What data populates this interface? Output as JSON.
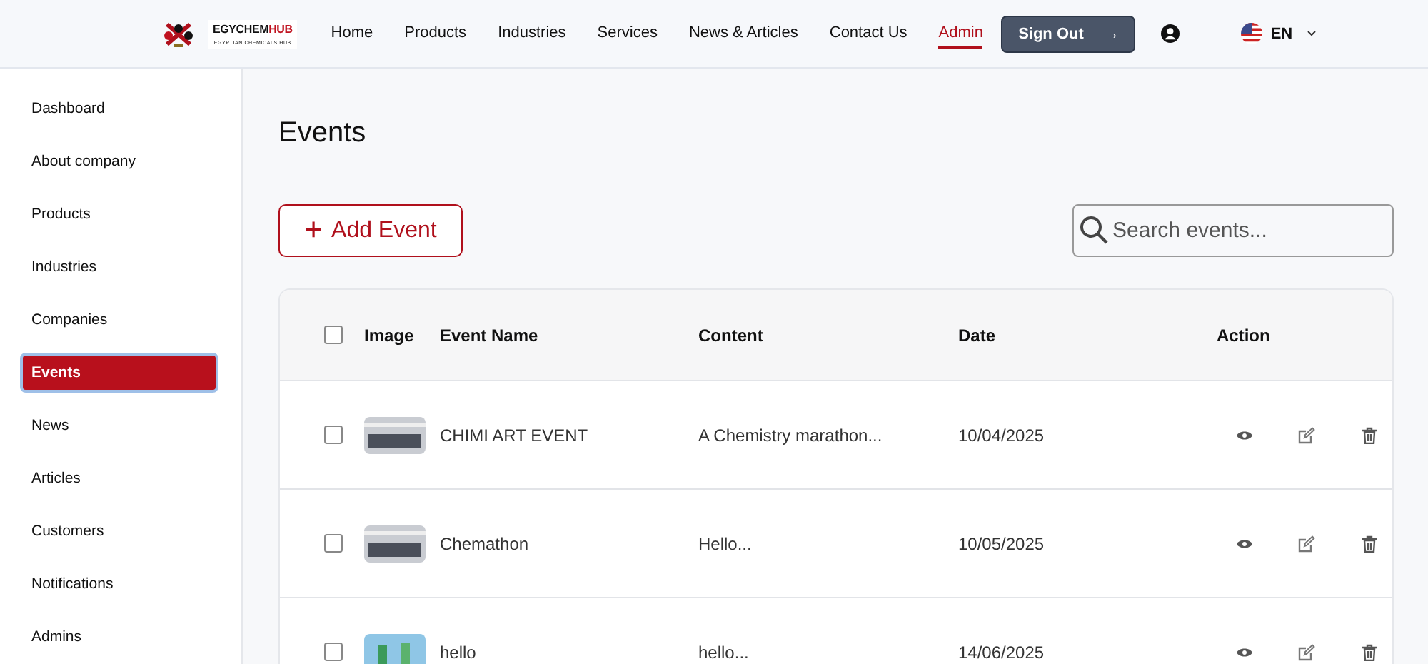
{
  "header": {
    "logo": {
      "name_main": "EGYCHEM",
      "name_accent": "HUB",
      "tagline": "EGYPTIAN CHEMICALS HUB"
    },
    "nav": [
      {
        "label": "Home",
        "selected": false
      },
      {
        "label": "Products",
        "selected": false
      },
      {
        "label": "Industries",
        "selected": false
      },
      {
        "label": "Services",
        "selected": false
      },
      {
        "label": "News & Articles",
        "selected": false
      },
      {
        "label": "Contact Us",
        "selected": false
      },
      {
        "label": "Admin",
        "selected": true
      }
    ],
    "sign_out": {
      "label": "Sign Out",
      "arrow": "→"
    },
    "language": "EN"
  },
  "sidebar": {
    "items": [
      {
        "label": "Dashboard",
        "selected": false
      },
      {
        "label": "About company",
        "selected": false
      },
      {
        "label": "Products",
        "selected": false
      },
      {
        "label": "Industries",
        "selected": false
      },
      {
        "label": "Companies",
        "selected": false
      },
      {
        "label": "Events",
        "selected": true
      },
      {
        "label": "News",
        "selected": false
      },
      {
        "label": "Articles",
        "selected": false
      },
      {
        "label": "Customers",
        "selected": false
      },
      {
        "label": "Notifications",
        "selected": false
      },
      {
        "label": "Admins",
        "selected": false
      }
    ]
  },
  "main": {
    "title": "Events",
    "add_button": {
      "icon": "+",
      "label": "Add Event"
    },
    "search": {
      "placeholder": "Search events..."
    },
    "table": {
      "select_all_checked": false,
      "columns": [
        "Image",
        "Event Name",
        "Content",
        "Date",
        "Action"
      ],
      "rows": [
        {
          "checked": false,
          "name": "CHIMI ART EVENT",
          "content": "A Chemistry marathon...",
          "date": "10/04/2025"
        },
        {
          "checked": false,
          "name": "Chemathon",
          "content": "Hello...",
          "date": "10/05/2025"
        },
        {
          "checked": false,
          "name": "hello",
          "content": "hello...",
          "date": "14/06/2025"
        }
      ]
    }
  }
}
